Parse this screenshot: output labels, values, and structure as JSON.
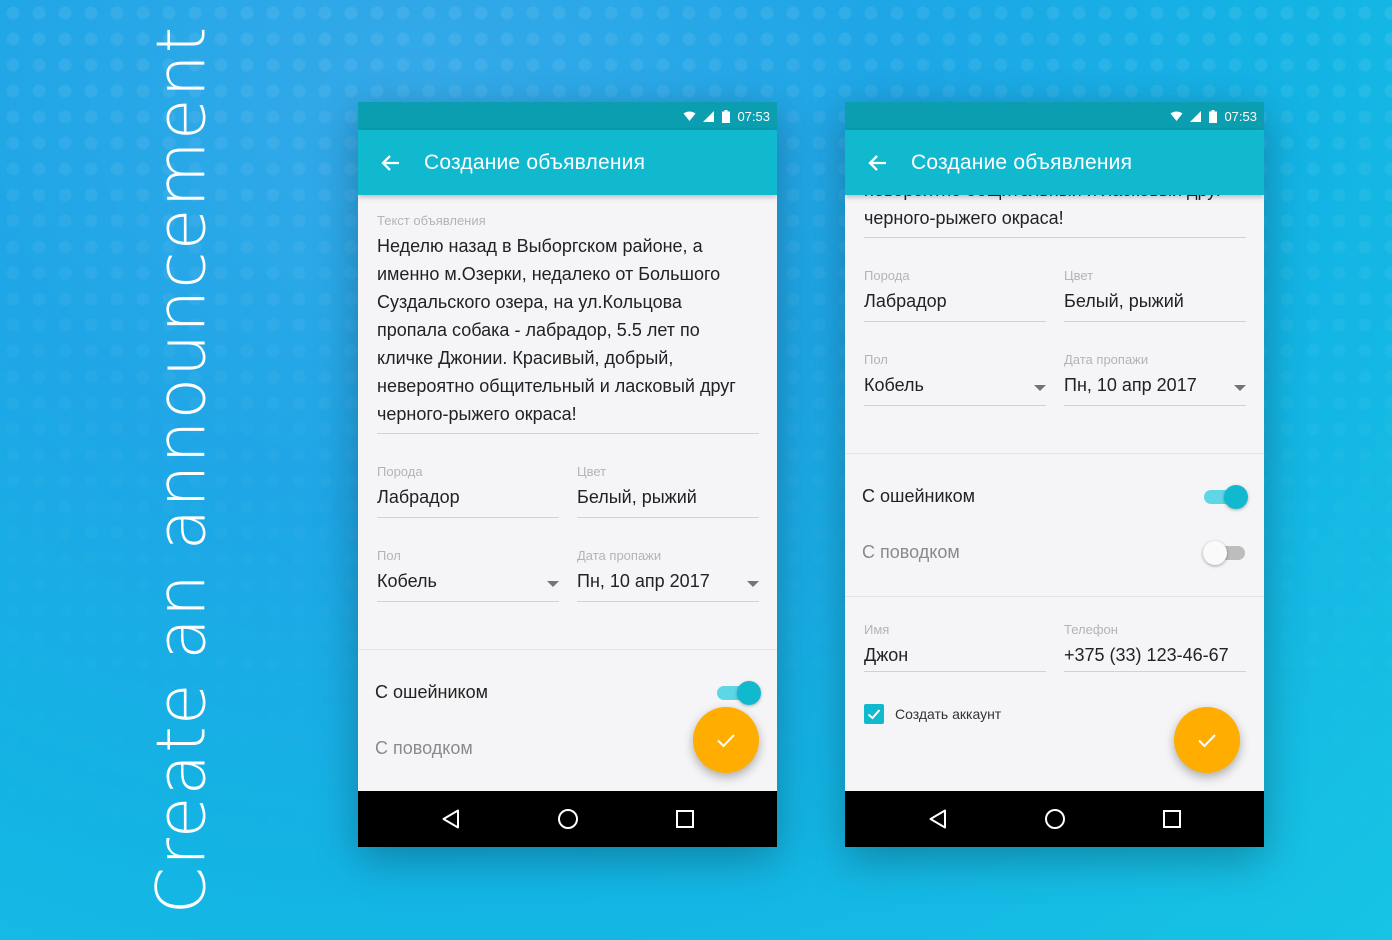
{
  "colors": {
    "accent": "#11b9cf",
    "status_bar": "#0b9eb1",
    "fab": "#ffad00",
    "nav_bar": "#000000",
    "surface": "#f5f5f7"
  },
  "caption": "Create an announcement",
  "status": {
    "time": "07:53"
  },
  "app_bar": {
    "title": "Создание объявления"
  },
  "form": {
    "description_label": "Текст объявления",
    "description_lines": [
      "Неделю назад в Выборгском районе, а",
      "именно м.Озерки, недалеко от Большого",
      "Суздальского озера, на ул.Кольцова",
      "пропала собака - лабрадор, 5.5 лет по",
      "кличке Джонии. Красивый, добрый,",
      "невероятно общительный и ласковый друг",
      "черного-рыжего окраса!"
    ],
    "breed_label": "Порода",
    "breed_value": "Лабрадор",
    "color_label": "Цвет",
    "color_value": "Белый, рыжий",
    "sex_label": "Пол",
    "sex_value": "Кобель",
    "date_label": "Дата пропажи",
    "date_value": "Пн, 10 апр 2017",
    "collar_label": "С ошейником",
    "collar_on": true,
    "leash_label": "С поводком",
    "leash_on": false,
    "name_label": "Имя",
    "name_value": "Джон",
    "phone_label": "Телефон",
    "phone_value": "+375 (33) 123-46-67",
    "create_account_label": "Создать аккаунт",
    "create_account_checked": true
  },
  "icons": {
    "status": [
      "wifi-icon",
      "signal-icon",
      "battery-icon"
    ],
    "back": "arrow-back-icon",
    "fab": "check-icon",
    "nav": [
      "nav-back-icon",
      "nav-home-icon",
      "nav-recents-icon"
    ]
  }
}
